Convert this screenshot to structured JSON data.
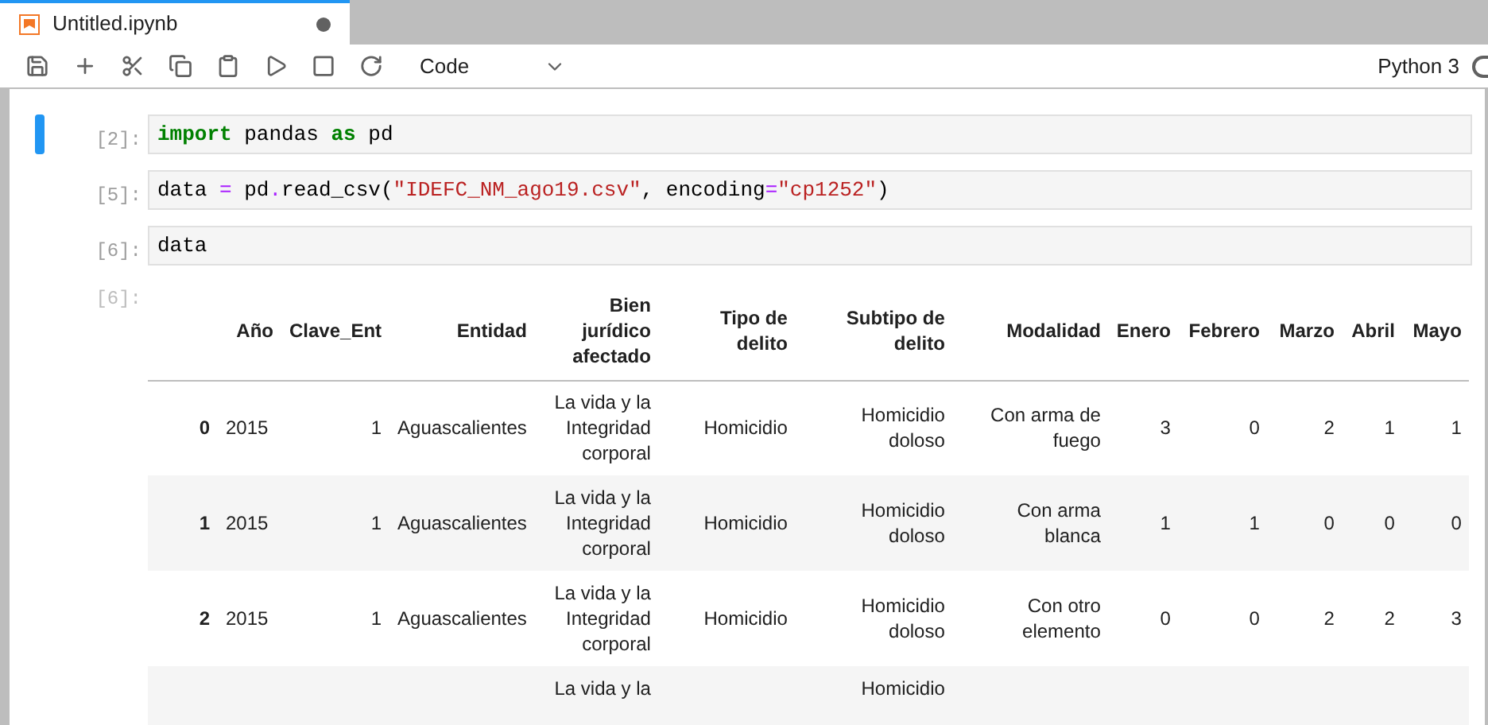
{
  "tab": {
    "title": "Untitled.ipynb",
    "unsaved": true
  },
  "toolbar": {
    "cell_type": "Code",
    "kernel": "Python 3"
  },
  "cells": [
    {
      "prompt": "[2]:",
      "selected": true,
      "code": [
        {
          "kind": "keyword",
          "text": "import"
        },
        {
          "kind": "plain",
          "text": " pandas "
        },
        {
          "kind": "keyword",
          "text": "as"
        },
        {
          "kind": "plain",
          "text": " pd"
        }
      ]
    },
    {
      "prompt": "[5]:",
      "selected": false,
      "code": [
        {
          "kind": "plain",
          "text": "data "
        },
        {
          "kind": "operator",
          "text": "="
        },
        {
          "kind": "plain",
          "text": " pd"
        },
        {
          "kind": "operator",
          "text": "."
        },
        {
          "kind": "plain",
          "text": "read_csv("
        },
        {
          "kind": "string",
          "text": "\"IDEFC_NM_ago19.csv\""
        },
        {
          "kind": "plain",
          "text": ", encoding"
        },
        {
          "kind": "operator",
          "text": "="
        },
        {
          "kind": "string",
          "text": "\"cp1252\""
        },
        {
          "kind": "plain",
          "text": ")"
        }
      ]
    },
    {
      "prompt": "[6]:",
      "selected": false,
      "code": [
        {
          "kind": "plain",
          "text": "data"
        }
      ]
    }
  ],
  "output": {
    "prompt": "[6]:",
    "table": {
      "columns": [
        "",
        "Año",
        "Clave_Ent",
        "Entidad",
        "Bien jurídico afectado",
        "Tipo de delito",
        "Subtipo de delito",
        "Modalidad",
        "Enero",
        "Febrero",
        "Marzo",
        "Abril",
        "Mayo"
      ],
      "rows": [
        [
          "0",
          "2015",
          "1",
          "Aguascalientes",
          "La vida y la Integridad corporal",
          "Homicidio",
          "Homicidio doloso",
          "Con arma de fuego",
          "3",
          "0",
          "2",
          "1",
          "1"
        ],
        [
          "1",
          "2015",
          "1",
          "Aguascalientes",
          "La vida y la Integridad corporal",
          "Homicidio",
          "Homicidio doloso",
          "Con arma blanca",
          "1",
          "1",
          "0",
          "0",
          "0"
        ],
        [
          "2",
          "2015",
          "1",
          "Aguascalientes",
          "La vida y la Integridad corporal",
          "Homicidio",
          "Homicidio doloso",
          "Con otro elemento",
          "0",
          "0",
          "2",
          "2",
          "3"
        ],
        [
          null,
          null,
          null,
          null,
          "La vida y la",
          null,
          "Homicidio",
          null,
          null,
          null,
          null,
          null,
          null
        ]
      ]
    }
  }
}
